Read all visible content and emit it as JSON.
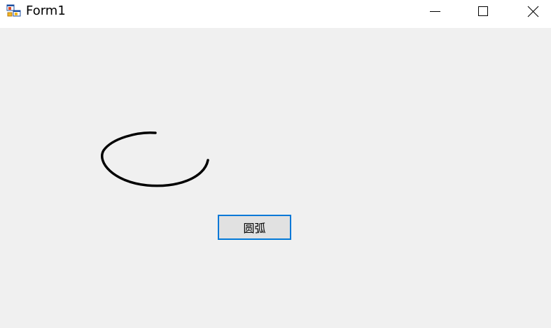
{
  "window": {
    "title": "Form1",
    "icons": {
      "app": "winforms-app-icon",
      "minimize": "minimize-icon",
      "maximize": "maximize-icon",
      "close": "close-icon"
    }
  },
  "client": {
    "button_label": "圆弧"
  },
  "colors": {
    "client_background": "#f0f0f0",
    "titlebar_background": "#ffffff",
    "button_border": "#0078d7",
    "button_face": "#e1e1e1",
    "arc_stroke": "#000000"
  }
}
